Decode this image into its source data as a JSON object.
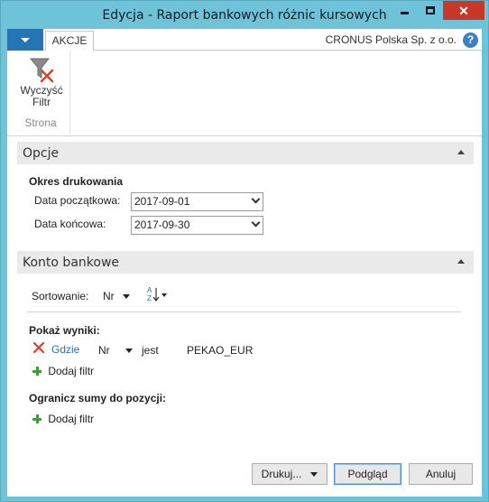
{
  "window": {
    "title": "Edycja - Raport bankowych różnic kursowych",
    "close_symbol": "✕"
  },
  "ribbon": {
    "tab_actions": "AKCJE",
    "company": "CRONUS Polska Sp. z o.o.",
    "help_symbol": "?",
    "clear_filter_line1": "Wyczyść",
    "clear_filter_line2": "Filtr",
    "clear_filter_icon": "funnel-clear-icon",
    "group_label": "Strona"
  },
  "options": {
    "header": "Opcje",
    "period_title": "Okres drukowania",
    "start_label": "Data początkowa:",
    "start_value": "2017-09-01",
    "end_label": "Data końcowa:",
    "end_value": "2017-09-30"
  },
  "bank": {
    "header": "Konto bankowe",
    "sort_label": "Sortowanie:",
    "sort_value": "Nr",
    "sort_icon_text": "AZ",
    "show_results": "Pokaż wyniki:",
    "filter_where": "Gdzie",
    "filter_field": "Nr",
    "filter_op": "jest",
    "filter_value": "PEKAO_EUR",
    "add_filter": "Dodaj filtr",
    "limit_totals": "Ogranicz sumy do pozycji:",
    "add_filter_2": "Dodaj filtr"
  },
  "buttons": {
    "print": "Drukuj...",
    "preview": "Podgląd",
    "cancel": "Anuluj"
  },
  "colors": {
    "window_frame": "#6fc3d9",
    "accent_blue": "#2475b6",
    "close_red": "#c7382b",
    "link": "#2a6fb9",
    "remove_red": "#d9432f",
    "add_green": "#3e9e3a"
  }
}
